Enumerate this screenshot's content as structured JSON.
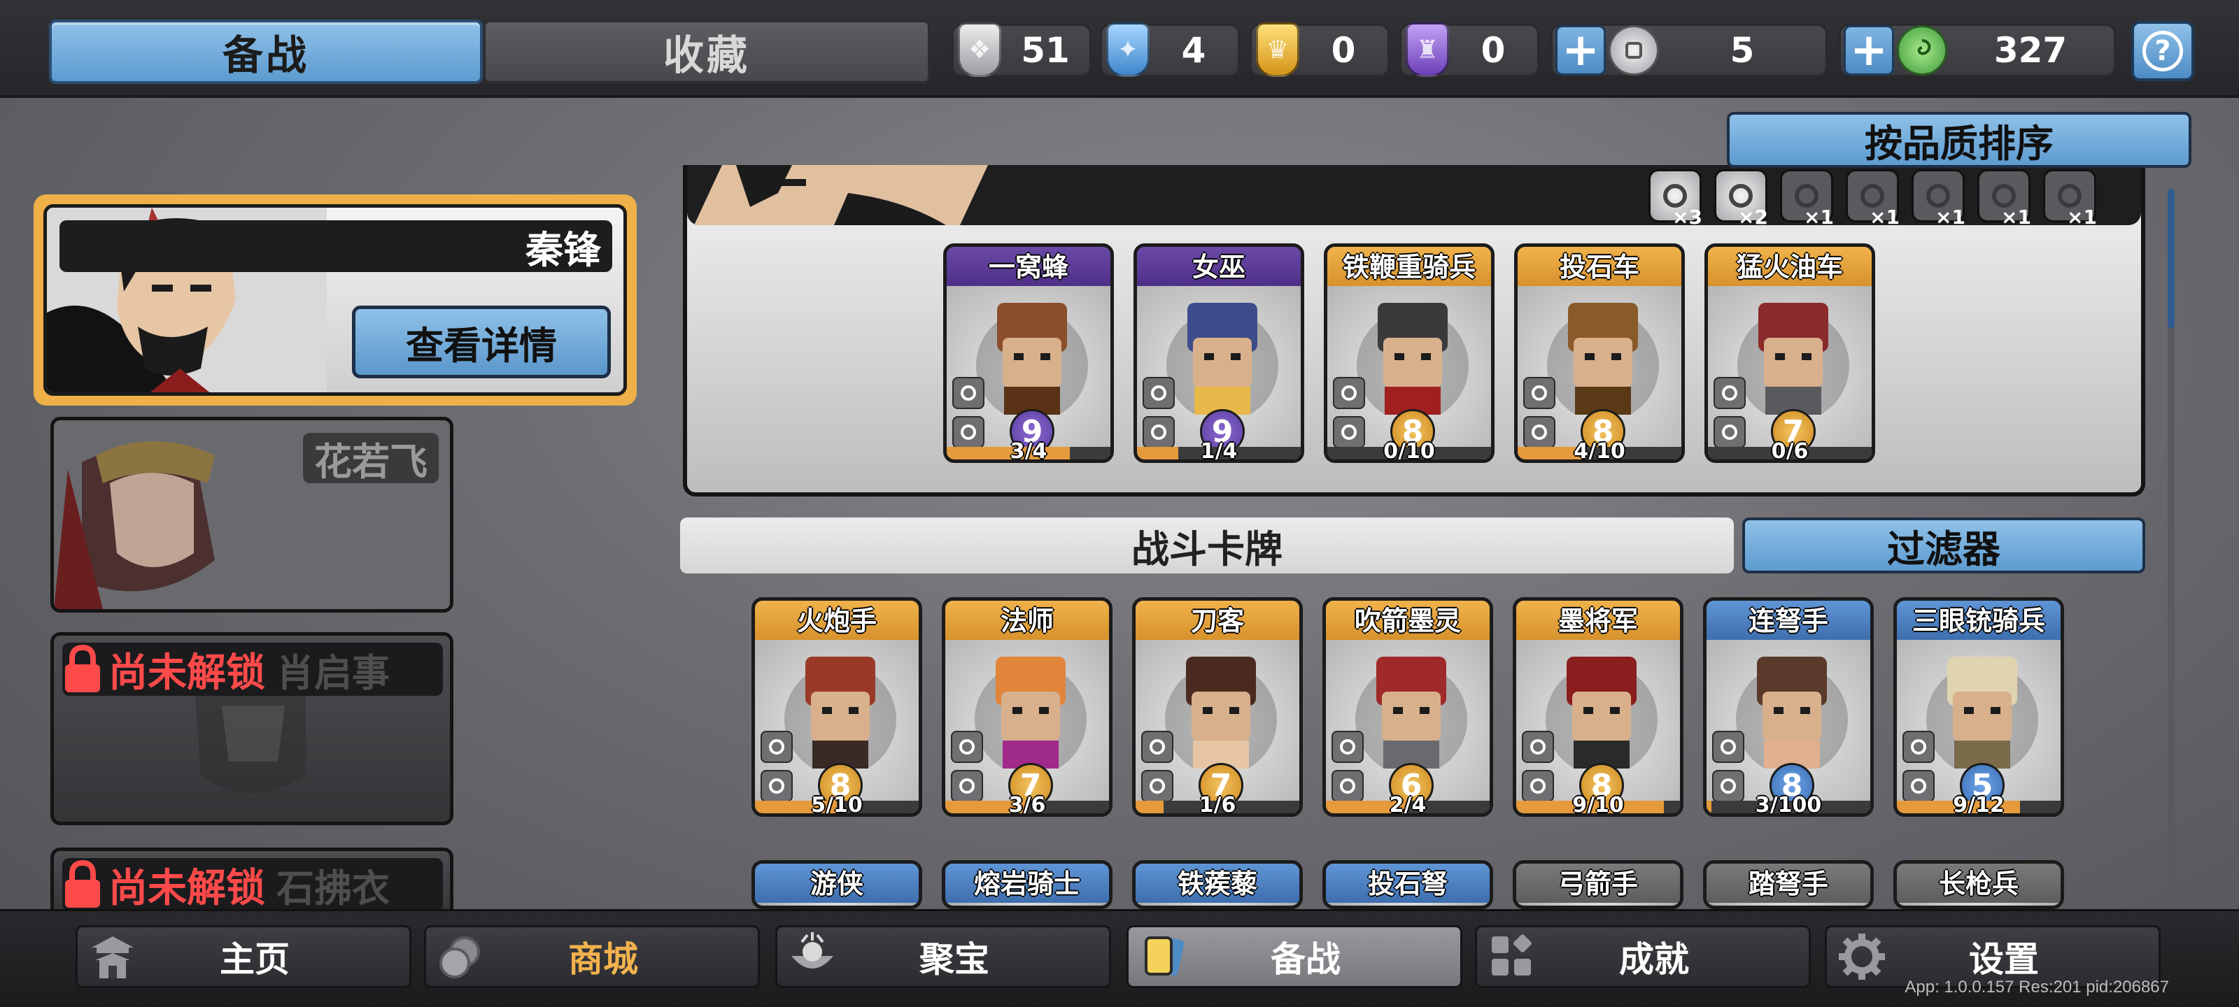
{
  "tabs": {
    "active": "备战",
    "inactive": "收藏"
  },
  "resources": [
    {
      "name": "silver-shield-icon",
      "value": "51",
      "color": "#c9c9cf"
    },
    {
      "name": "blue-shield-icon",
      "value": "4",
      "color": "#5aa7e8"
    },
    {
      "name": "gold-shield-icon",
      "value": "0",
      "color": "#f2b83a"
    },
    {
      "name": "purple-shield-icon",
      "value": "0",
      "color": "#8a5fd0"
    }
  ],
  "currency": [
    {
      "name": "silver-coin-icon",
      "value": "5"
    },
    {
      "name": "jade-coin-icon",
      "value": "327"
    }
  ],
  "heroes": [
    {
      "name": "秦锋",
      "detail_button": "查看详情",
      "state": "selected"
    },
    {
      "name": "花若飞",
      "state": "available"
    },
    {
      "name": "肖启事",
      "lock_text": "尚未解锁",
      "state": "locked"
    },
    {
      "name": "石拂衣",
      "lock_text": "尚未解锁",
      "state": "locked"
    }
  ],
  "sort_button": "按品质排序",
  "modifiers": [
    {
      "count": "×3",
      "active": true
    },
    {
      "count": "×2",
      "active": true
    },
    {
      "count": "×1",
      "active": false
    },
    {
      "count": "×1",
      "active": false
    },
    {
      "count": "×1",
      "active": false
    },
    {
      "count": "×1",
      "active": false
    },
    {
      "count": "×1",
      "active": false
    }
  ],
  "deck_cards": [
    {
      "name": "一窝蜂",
      "rarity": "purple",
      "level": "9",
      "progress": "3/4",
      "fraction": 0.75
    },
    {
      "name": "女巫",
      "rarity": "purple",
      "level": "9",
      "progress": "1/4",
      "fraction": 0.25
    },
    {
      "name": "铁鞭重骑兵",
      "rarity": "gold",
      "level": "8",
      "progress": "0/10",
      "fraction": 0
    },
    {
      "name": "投石车",
      "rarity": "gold",
      "level": "8",
      "progress": "4/10",
      "fraction": 0.4
    },
    {
      "name": "猛火油车",
      "rarity": "gold",
      "level": "7",
      "progress": "0/6",
      "fraction": 0
    }
  ],
  "battle_cards_label": "战斗卡牌",
  "filter_button": "过滤器",
  "battle_cards": [
    {
      "name": "火炮手",
      "rarity": "gold",
      "level": "8",
      "progress": "5/10",
      "fraction": 0.5
    },
    {
      "name": "法师",
      "rarity": "gold",
      "level": "7",
      "progress": "3/6",
      "fraction": 0.5
    },
    {
      "name": "刀客",
      "rarity": "gold",
      "level": "7",
      "progress": "1/6",
      "fraction": 0.17
    },
    {
      "name": "吹箭墨灵",
      "rarity": "gold",
      "level": "6",
      "progress": "2/4",
      "fraction": 0.5
    },
    {
      "name": "墨将军",
      "rarity": "gold",
      "level": "8",
      "progress": "9/10",
      "fraction": 0.9
    },
    {
      "name": "连弩手",
      "rarity": "blue",
      "level": "8",
      "progress": "3/100",
      "fraction": 0.03
    },
    {
      "name": "三眼铳骑兵",
      "rarity": "blue",
      "level": "5",
      "progress": "9/12",
      "fraction": 0.75
    }
  ],
  "more_cards": [
    {
      "name": "游侠",
      "rarity": "blue"
    },
    {
      "name": "熔岩骑士",
      "rarity": "blue"
    },
    {
      "name": "铁蒺藜",
      "rarity": "blue"
    },
    {
      "name": "投石弩",
      "rarity": "blue"
    },
    {
      "name": "弓箭手",
      "rarity": "gray"
    },
    {
      "name": "踏弩手",
      "rarity": "gray"
    },
    {
      "name": "长枪兵",
      "rarity": "gray"
    }
  ],
  "nav": [
    {
      "label": "主页",
      "icon": "pagoda-icon"
    },
    {
      "label": "商城",
      "icon": "coins-icon"
    },
    {
      "label": "聚宝",
      "icon": "treasure-bowl-icon"
    },
    {
      "label": "备战",
      "icon": "cards-icon"
    },
    {
      "label": "成就",
      "icon": "achievements-icon"
    },
    {
      "label": "设置",
      "icon": "gear-icon"
    }
  ],
  "version": "App: 1.0.0.157 Res:201 pid:206867"
}
